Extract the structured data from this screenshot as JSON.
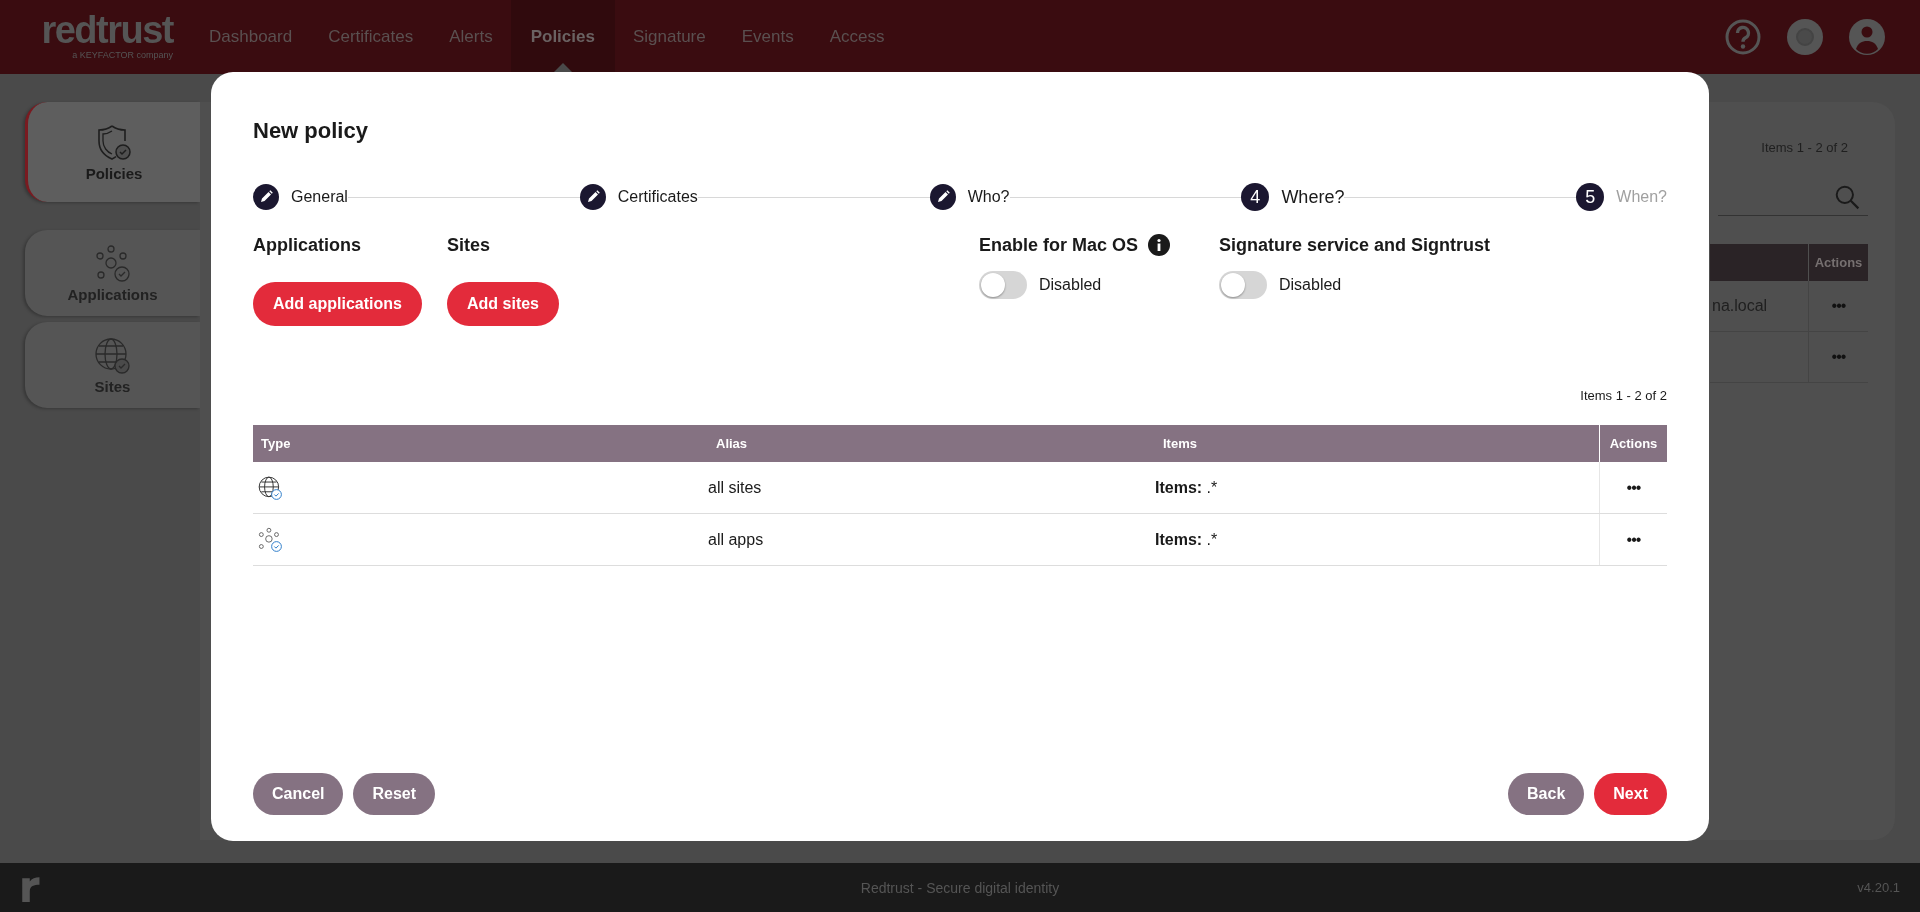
{
  "header": {
    "logo": {
      "wordmark": "redtrust",
      "tagline": "a KEYFACTOR company"
    },
    "nav": [
      {
        "label": "Dashboard",
        "selected": false
      },
      {
        "label": "Certificates",
        "selected": false
      },
      {
        "label": "Alerts",
        "selected": false
      },
      {
        "label": "Policies",
        "selected": true
      },
      {
        "label": "Signature",
        "selected": false
      },
      {
        "label": "Events",
        "selected": false
      },
      {
        "label": "Access",
        "selected": false
      }
    ]
  },
  "sidebar": {
    "items": [
      {
        "label": "Policies",
        "kind": "policies",
        "selected": true
      },
      {
        "label": "Applications",
        "kind": "applications",
        "selected": false
      },
      {
        "label": "Sites",
        "kind": "sites",
        "selected": false
      }
    ]
  },
  "background_list": {
    "pagination": "Items 1 - 2 of 2",
    "columns": [
      "Actions"
    ],
    "rows": [
      {
        "column_1": "na.local",
        "actions": "•••"
      },
      {
        "actions": "•••"
      }
    ]
  },
  "modal": {
    "title": "New policy",
    "steps": [
      {
        "label": "General",
        "completed": true,
        "disabled": false
      },
      {
        "label": "Certificates",
        "completed": true,
        "disabled": false
      },
      {
        "label": "Who?",
        "completed": true,
        "disabled": false
      },
      {
        "number": "4",
        "label": "Where?",
        "completed": false,
        "disabled": false
      },
      {
        "number": "5",
        "label": "When?",
        "completed": false,
        "disabled": true
      }
    ],
    "sections": [
      {
        "kind": "button",
        "heading": "Applications",
        "button": "Add applications"
      },
      {
        "kind": "button",
        "heading": "Sites",
        "button": "Add sites"
      },
      {
        "kind": "toggle",
        "heading": "Enable for Mac OS",
        "info": true,
        "on": false,
        "state_label": "Disabled"
      },
      {
        "kind": "toggle",
        "heading": "Signature service and Signtrust",
        "info": false,
        "on": false,
        "state_label": "Disabled"
      }
    ],
    "table": {
      "pagination": "Items 1 - 2 of 2",
      "columns": [
        "Type",
        "Alias",
        "Items",
        "Actions"
      ],
      "rows": [
        {
          "kind": "site",
          "alias": "all sites",
          "items": "**Items:** .*",
          "actions": "•••"
        },
        {
          "kind": "app",
          "alias": "all apps",
          "items": "**Items:** .*",
          "actions": "•••"
        }
      ]
    },
    "left_buttons": [
      {
        "label": "Cancel",
        "primary": false
      },
      {
        "label": "Reset",
        "primary": false
      }
    ],
    "right_buttons": [
      {
        "label": "Back",
        "primary": false
      },
      {
        "label": "Next",
        "primary": true
      }
    ]
  },
  "footer": {
    "text": "Redtrust - Secure digital identity",
    "version": "v4.20.1"
  }
}
